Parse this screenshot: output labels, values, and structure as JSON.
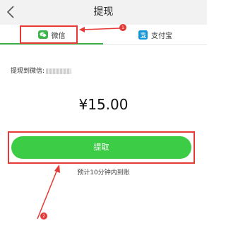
{
  "header": {
    "title": "提现"
  },
  "tabs": [
    {
      "label": "微信",
      "icon": "wechat-icon",
      "active": true
    },
    {
      "label": "支付宝",
      "icon": "alipay-icon",
      "active": false
    }
  ],
  "form": {
    "withdraw_to_label": "提现到微信:",
    "amount": "¥15.00",
    "submit_label": "提取",
    "eta_text": "预计10分钟内到账"
  },
  "annotations": [
    {
      "badge": "1"
    },
    {
      "badge": "2"
    }
  ],
  "colors": {
    "accent_green": "#3ccc45",
    "tab_green": "#3bb54a",
    "annotation_red": "#e53935"
  }
}
